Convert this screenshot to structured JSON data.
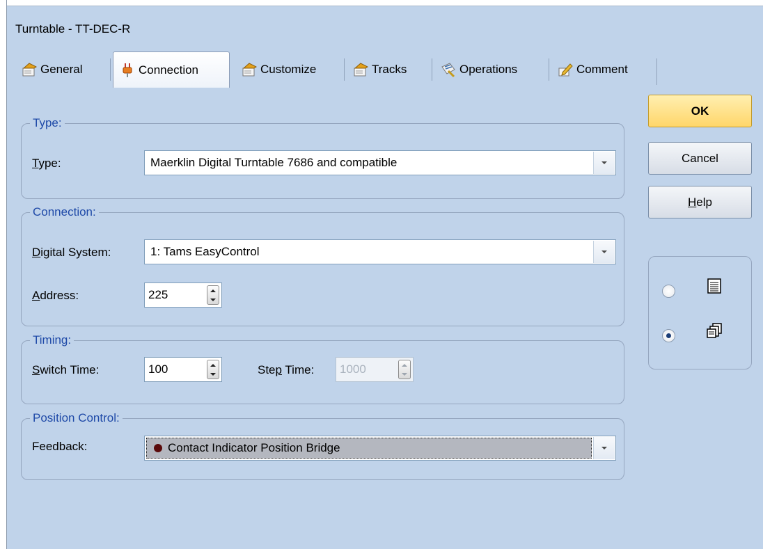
{
  "window": {
    "title": "Turntable - TT-DEC-R"
  },
  "tabs": [
    {
      "label": "General",
      "icon": "general-tab-icon"
    },
    {
      "label": "Connection",
      "icon": "plug-icon",
      "active": true
    },
    {
      "label": "Customize",
      "icon": "customize-tab-icon"
    },
    {
      "label": "Tracks",
      "icon": "tracks-tab-icon"
    },
    {
      "label": "Operations",
      "icon": "operations-tab-icon"
    },
    {
      "label": "Comment",
      "icon": "comment-pen-icon"
    }
  ],
  "type_group": {
    "legend": "Type:",
    "type_label_underlined": "T",
    "type_label_rest": "ype:",
    "type_value": "Maerklin Digital Turntable 7686 and compatible"
  },
  "connection_group": {
    "legend": "Connection:",
    "digital_system_label_underlined": "D",
    "digital_system_label_rest": "igital System:",
    "digital_system_value": "1: Tams EasyControl",
    "address_label_underlined": "A",
    "address_label_rest": "ddress:",
    "address_value": "225"
  },
  "timing_group": {
    "legend": "Timing:",
    "switch_time_label_underlined": "S",
    "switch_time_label_rest": "witch Time:",
    "switch_time_value": "100",
    "step_time_label_before": "Ste",
    "step_time_label_underlined": "p",
    "step_time_label_after": " Time:",
    "step_time_value": "1000"
  },
  "position_group": {
    "legend": "Position Control:",
    "feedback_label": "Feedback:",
    "feedback_value": "Contact Indicator Position Bridge",
    "feedback_status_color": "#5a0a0a"
  },
  "buttons": {
    "ok": "OK",
    "cancel": "Cancel",
    "help_underlined": "H",
    "help_rest": "elp"
  },
  "view_mode": {
    "options": [
      {
        "icon": "list-view-icon",
        "selected": false
      },
      {
        "icon": "multi-page-view-icon",
        "selected": true
      }
    ]
  },
  "colors": {
    "background": "#c0d3ea",
    "legend_text": "#1f4aa8",
    "ok_button": "#ffd66a"
  }
}
